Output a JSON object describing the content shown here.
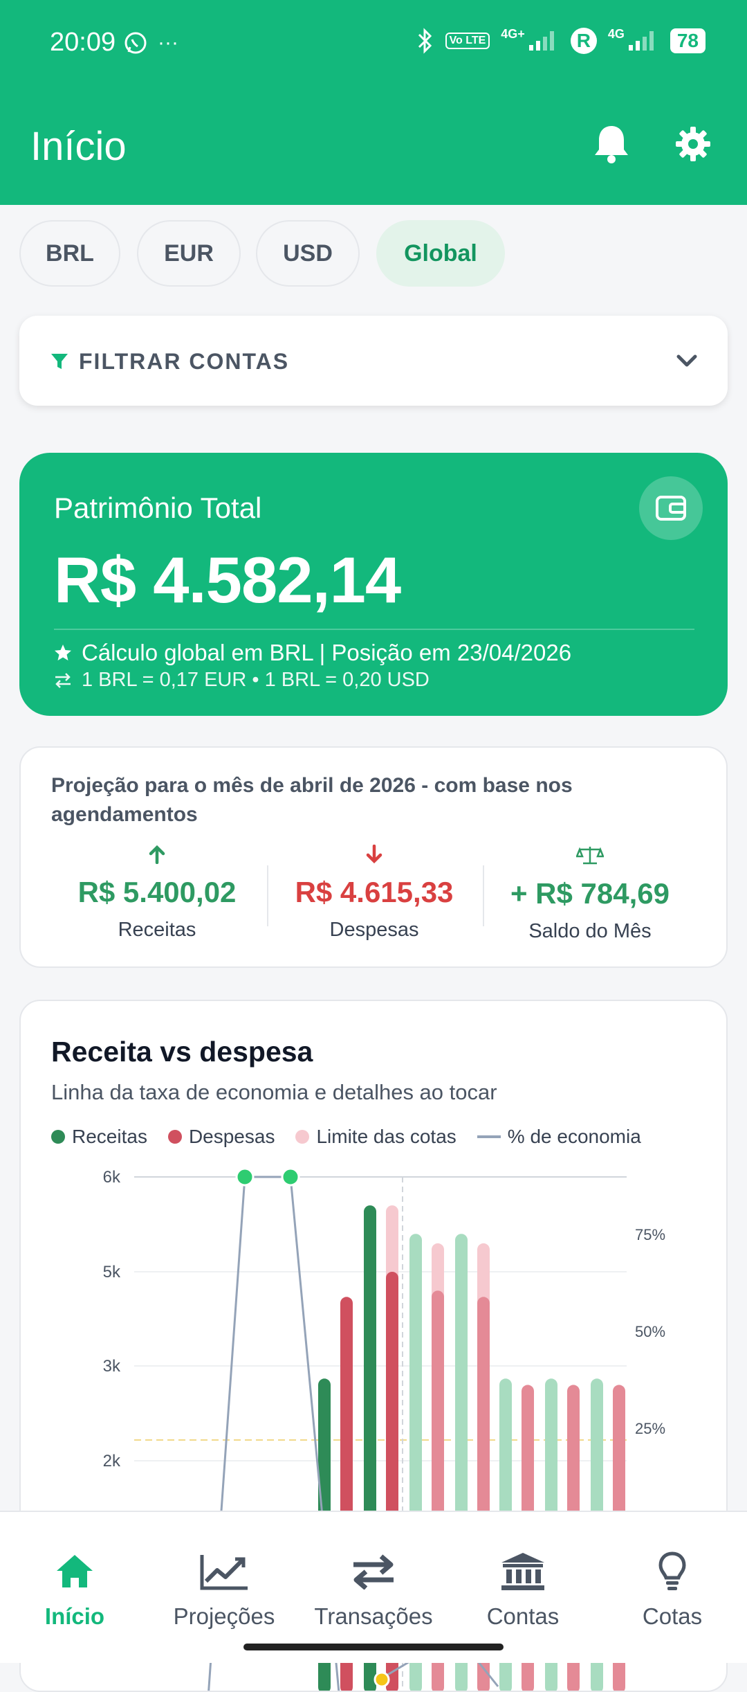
{
  "status_bar": {
    "time": "20:09",
    "network_1": "4G+",
    "network_2": "4G",
    "volte": "Vo LTE",
    "roaming": "R",
    "battery": "78"
  },
  "header": {
    "title": "Início"
  },
  "currency_chips": [
    "BRL",
    "EUR",
    "USD",
    "Global"
  ],
  "selected_chip": "Global",
  "filter": {
    "label": "FILTRAR CONTAS"
  },
  "patrimonio": {
    "label": "Patrimônio Total",
    "value": "R$ 4.582,14",
    "calc_info": "Cálculo global em BRL | Posição em 23/04/2026",
    "rates": "1 BRL = 0,17 EUR • 1 BRL = 0,20 USD"
  },
  "projection": {
    "title": "Projeção para o mês de abril de 2026 - com base nos agendamentos",
    "receitas": {
      "value": "R$ 5.400,02",
      "label": "Receitas"
    },
    "despesas": {
      "value": "R$ 4.615,33",
      "label": "Despesas"
    },
    "saldo": {
      "value": "+ R$ 784,69",
      "label": "Saldo do Mês"
    }
  },
  "chart_card": {
    "title": "Receita vs despesa",
    "subtitle": "Linha da taxa de economia e detalhes ao tocar",
    "legend": [
      "Receitas",
      "Despesas",
      "Limite das cotas",
      "% de economia"
    ]
  },
  "chart_data": {
    "type": "bar",
    "y_ticks": [
      "6k",
      "5k",
      "3k",
      "2k"
    ],
    "y_tick_values": [
      6000,
      5000,
      3500,
      2000
    ],
    "y2_ticks": [
      "75%",
      "50%",
      "25%"
    ],
    "y2_tick_values": [
      75,
      50,
      25
    ],
    "series": [
      {
        "name": "Receitas",
        "values": [
          null,
          null,
          null,
          null,
          3300,
          5700,
          5400,
          5400,
          3300,
          3300,
          3300
        ]
      },
      {
        "name": "Despesas",
        "values": [
          null,
          null,
          null,
          null,
          4600,
          5000,
          4700,
          4600,
          3200,
          3200,
          3200
        ]
      },
      {
        "name": "Limite das cotas",
        "values": [
          null,
          null,
          null,
          null,
          null,
          5700,
          5300,
          5300,
          null,
          null,
          null
        ]
      },
      {
        "name": "% de economia",
        "values": [
          -10,
          100,
          100,
          -20,
          null,
          0,
          16,
          16,
          null,
          null,
          null
        ]
      }
    ],
    "colors": {
      "receitas": "#2e8b57",
      "despesas": "#d0505f",
      "receitas_projected": "#a8dcc0",
      "despesas_projected": "#e48a96",
      "limite": "#f6c9cf",
      "economia": "#94a3b8",
      "point": "#2ecc71"
    }
  },
  "bottom_nav": [
    {
      "label": "Início",
      "icon": "home-icon",
      "active": true
    },
    {
      "label": "Projeções",
      "icon": "chart-line-icon",
      "active": false
    },
    {
      "label": "Transações",
      "icon": "exchange-icon",
      "active": false
    },
    {
      "label": "Contas",
      "icon": "bank-icon",
      "active": false
    },
    {
      "label": "Cotas",
      "icon": "lightbulb-icon",
      "active": false
    }
  ]
}
